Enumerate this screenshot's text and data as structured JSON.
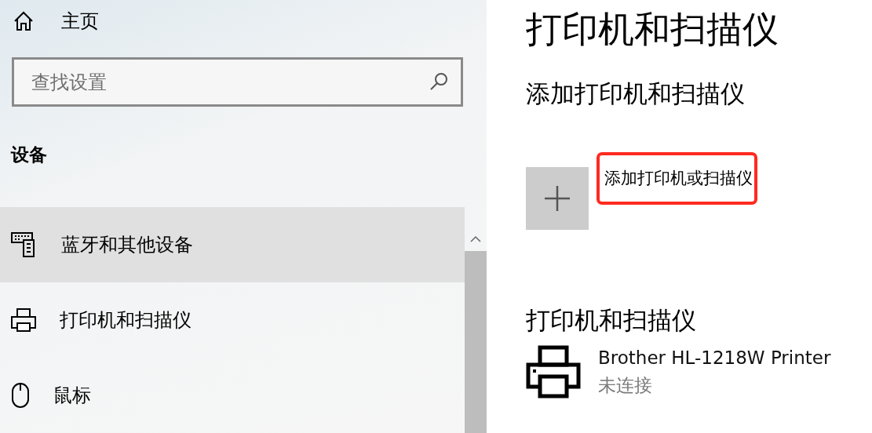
{
  "sidebar": {
    "home": {
      "label": "主页"
    },
    "search": {
      "placeholder": "查找设置"
    },
    "section_title": "设备",
    "items": [
      {
        "kind": "devices",
        "label": "蓝牙和其他设备",
        "selected": true
      },
      {
        "kind": "printers",
        "label": "打印机和扫描仪",
        "selected": false
      },
      {
        "kind": "mouse",
        "label": "鼠标",
        "selected": false
      }
    ]
  },
  "page": {
    "title": "打印机和扫描仪",
    "add_section": {
      "title": "添加打印机和扫描仪",
      "button": {
        "label": "添加打印机或扫描仪",
        "highlighted": true
      }
    },
    "list_section": {
      "title": "打印机和扫描仪",
      "devices": [
        {
          "name": "Brother HL-1218W Printer",
          "status": "未连接"
        }
      ]
    }
  }
}
